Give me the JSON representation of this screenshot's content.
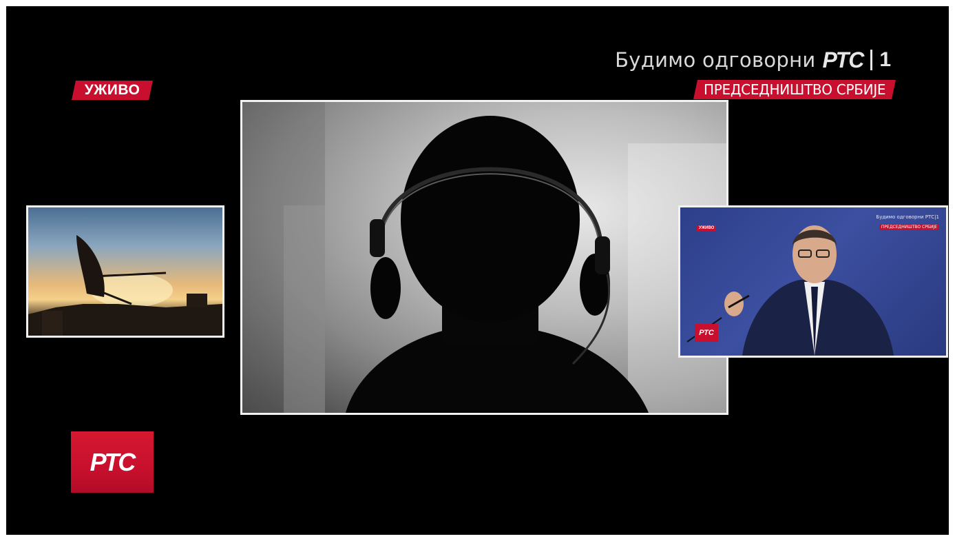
{
  "overlay": {
    "live_label": "УЖИВО",
    "tagline_text": "Будимо одговорни",
    "tagline_logo": "РТС",
    "tagline_channel": "1",
    "event_label": "ПРЕДСЕДНИШТВО СРБИЈЕ",
    "channel_logo": "РТС"
  },
  "inset_right": {
    "tagline": "Будимо одговорни РТС|1",
    "event_label": "ПРЕДСЕДНИШТВО СРБИЈЕ",
    "live_label": "УЖИВО",
    "logo": "РТС"
  },
  "colors": {
    "accent": "#c8102e",
    "background": "#000000",
    "frame_border": "#f2f2f2"
  },
  "icons": {
    "main_video": "headset-silhouette",
    "left_video": "satellite-dish",
    "right_video": "press-conference"
  }
}
